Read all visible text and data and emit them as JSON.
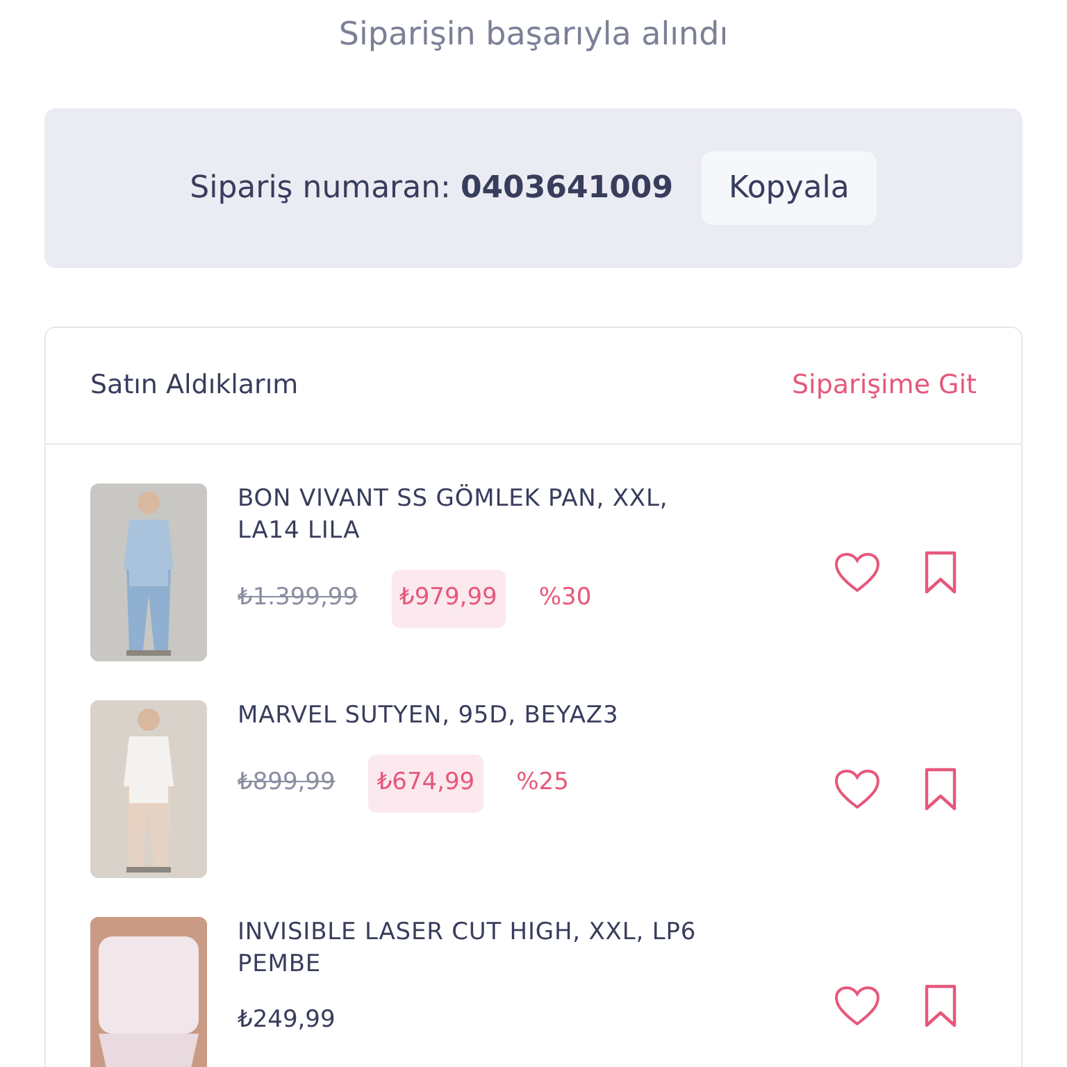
{
  "header": {
    "title": "Siparişin başarıyla alındı"
  },
  "order": {
    "label": "Sipariş numaran:",
    "number": "0403641009",
    "copy_button": "Kopyala"
  },
  "purchases": {
    "title": "Satın Aldıklarım",
    "link": "Siparişime Git",
    "items": [
      {
        "name": "BON VIVANT SS GÖMLEK PAN, XXL, LA14 LILA",
        "old_price": "₺1.399,99",
        "price": "₺979,99",
        "discount": "%30"
      },
      {
        "name": "MARVEL SUTYEN, 95D, BEYAZ3",
        "old_price": "₺899,99",
        "price": "₺674,99",
        "discount": "%25"
      },
      {
        "name": "INVISIBLE LASER CUT HIGH, XXL, LP6 PEMBE",
        "price": "₺249,99"
      }
    ]
  }
}
